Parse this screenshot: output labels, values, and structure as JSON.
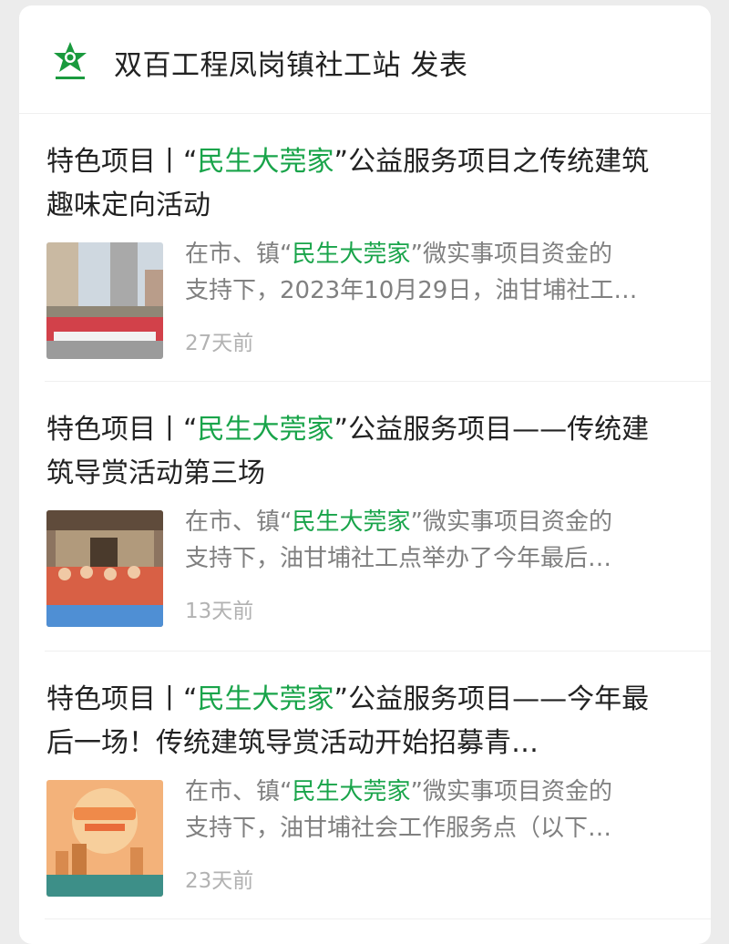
{
  "header": {
    "account_name": "双百工程凤岗镇社工站",
    "action": "发表",
    "logo_icon": "green-star-logo-icon"
  },
  "accent_color": "#19a44a",
  "articles": [
    {
      "title_prefix": "特色项目丨“",
      "title_highlight": "民生大莞家",
      "title_suffix": "”公益服务项目之传统建筑趣味定向活动",
      "summary_prefix": "在市、镇“",
      "summary_highlight": "民生大莞家",
      "summary_suffix": "”微实事项目资金的",
      "summary_line2": "支持下，2023年10月29日，油甘埔社工…",
      "time": "27天前",
      "thumb": "group-photo-buildings"
    },
    {
      "title_prefix": "特色项目丨“",
      "title_highlight": "民生大莞家",
      "title_suffix": "”公益服务项目——传统建筑导赏活动第三场",
      "summary_prefix": "在市、镇“",
      "summary_highlight": "民生大莞家",
      "summary_suffix": "”微实事项目资金的",
      "summary_line2": "支持下，油甘埔社工点举办了今年最后…",
      "time": "13天前",
      "thumb": "group-photo-old-house"
    },
    {
      "title_prefix": "特色项目丨“",
      "title_highlight": "民生大莞家",
      "title_suffix": "”公益服务项目——今年最后一场！传统建筑导赏活动开始招募青…",
      "summary_prefix": "在市、镇“",
      "summary_highlight": "民生大莞家",
      "summary_suffix": "”微实事项目资金的",
      "summary_line2": "支持下，油甘埔社会工作服务点（以下…",
      "time": "23天前",
      "thumb": "orange-poster"
    }
  ]
}
